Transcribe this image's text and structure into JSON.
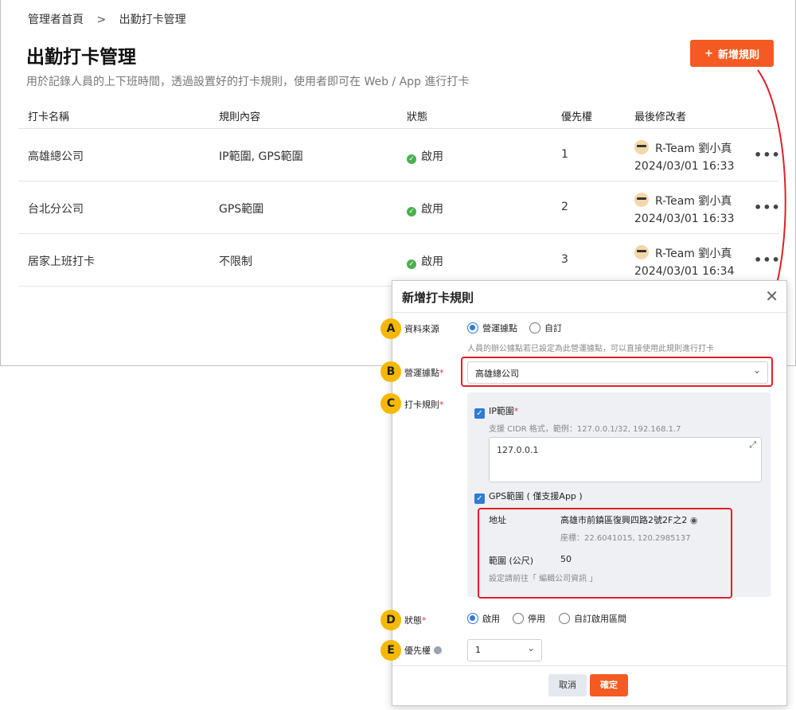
{
  "breadcrumb": {
    "home": "管理者首頁",
    "sep": ">",
    "current": "出勤打卡管理"
  },
  "header": {
    "title": "出勤打卡管理",
    "description": "用於記錄人員的上下班時間，透過設置好的打卡規則，使用者即可在 Web / App 進行打卡",
    "add_button": "新增規則",
    "add_icon": "+"
  },
  "table": {
    "columns": [
      "打卡名稱",
      "規則內容",
      "狀態",
      "優先權",
      "最後修改者"
    ],
    "rows": [
      {
        "name": "高雄總公司",
        "rule": "IP範圍, GPS範圍",
        "status": "啟用",
        "priority": "1",
        "editor": "R-Team 劉小真",
        "time": "2024/03/01 16:33"
      },
      {
        "name": "台北分公司",
        "rule": "GPS範圍",
        "status": "啟用",
        "priority": "2",
        "editor": "R-Team 劉小真",
        "time": "2024/03/01 16:33"
      },
      {
        "name": "居家上班打卡",
        "rule": "不限制",
        "status": "啟用",
        "priority": "3",
        "editor": "R-Team 劉小真",
        "time": "2024/03/01 16:34"
      }
    ],
    "more_icon": "•••"
  },
  "modal": {
    "title": "新增打卡規則",
    "close_icon": "✕",
    "badges": [
      "A",
      "B",
      "C",
      "D",
      "E"
    ],
    "source": {
      "label": "資料來源",
      "options": [
        "營運據點",
        "自訂"
      ],
      "selected": "營運據點",
      "hint": "人員的辦公據點若已設定為此營運據點，可以直接使用此規則進行打卡"
    },
    "site": {
      "label": "營運據點",
      "value": "高雄總公司"
    },
    "rule": {
      "label": "打卡規則",
      "ip_label": "IP範圍",
      "ip_hint": "支援 CIDR 格式，範例：127.0.0.1/32, 192.168.1.7",
      "ip_value": "127.0.0.1",
      "gps_label": "GPS範圍 ( 僅支援App )",
      "address_label": "地址",
      "address_value": "高雄市前鎮區復興四路2號2F之2",
      "coords": "座標：22.6041015, 120.2985137",
      "range_label": "範圍 (公尺)",
      "range_value": "50",
      "range_hint": "設定請前往「 編輯公司資訊 」"
    },
    "status": {
      "label": "狀態",
      "options": [
        "啟用",
        "停用",
        "自訂啟用區間"
      ],
      "selected": "啟用"
    },
    "priority": {
      "label": "優先權",
      "value": "1"
    },
    "cancel": "取消",
    "ok": "確定"
  },
  "colors": {
    "accent": "#f45a22",
    "primary": "#2f7bd6",
    "highlight": "#e0202a",
    "badge": "#f6b800",
    "success": "#4caf50"
  }
}
